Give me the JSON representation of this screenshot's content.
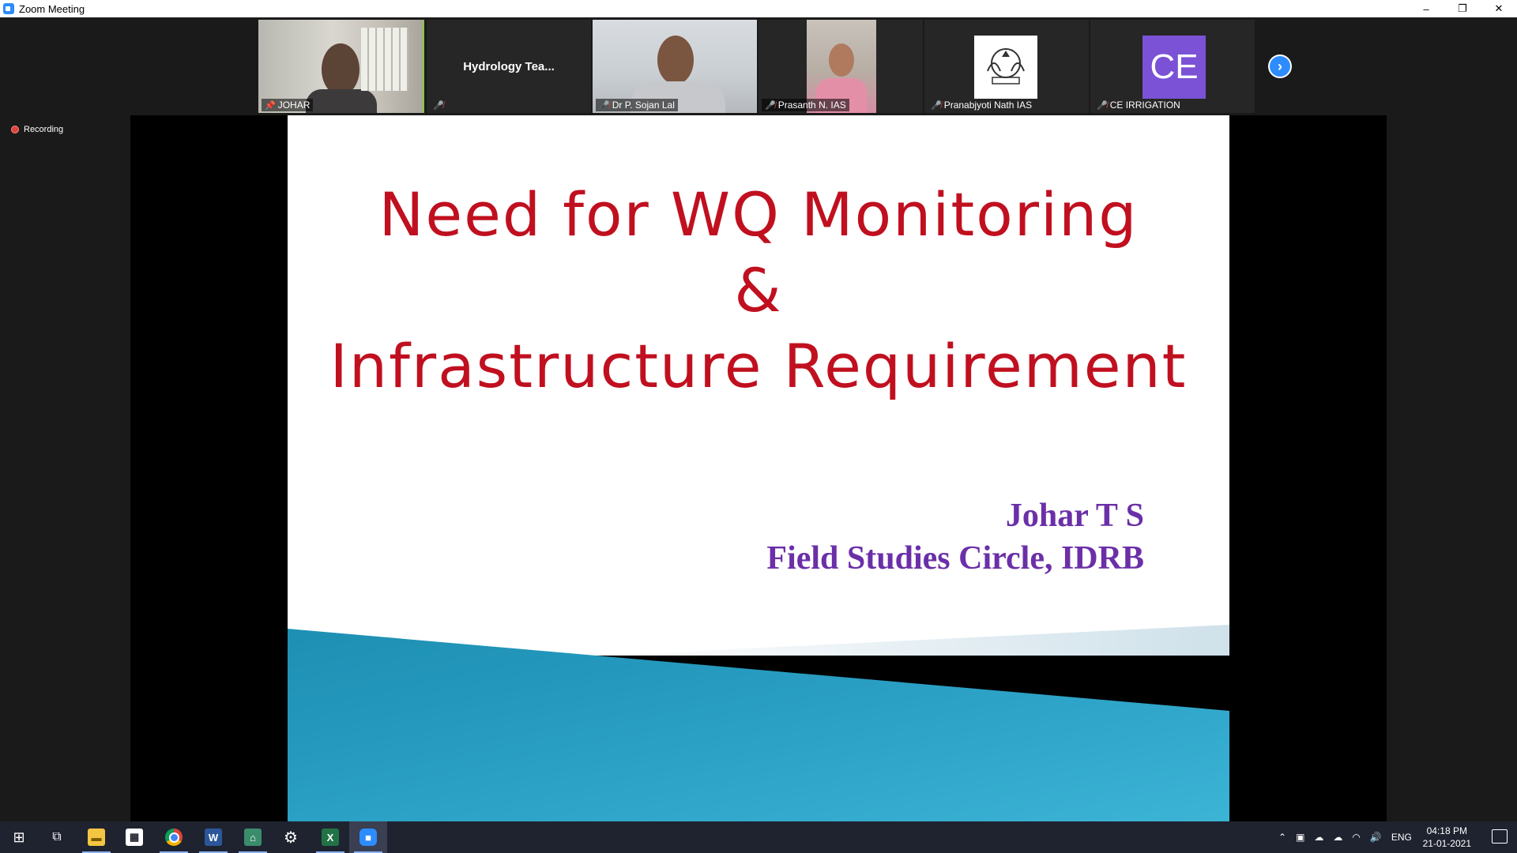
{
  "window": {
    "title": "Zoom Meeting",
    "controls": [
      "–",
      "❐",
      "✕"
    ]
  },
  "participants": [
    {
      "name": "JOHAR",
      "type": "video",
      "pinned": true,
      "active_speaker": true,
      "muted": false
    },
    {
      "name": "Hydrology  Tea...",
      "type": "name_only",
      "muted": true
    },
    {
      "name": "Dr P. Sojan Lal",
      "type": "video",
      "muted": true
    },
    {
      "name": "Prasanth N. IAS",
      "type": "video",
      "muted": true
    },
    {
      "name": "Pranabjyoti Nath IAS",
      "type": "image",
      "muted": true
    },
    {
      "name": "CE IRRIGATION",
      "type": "avatar",
      "initials": "CE",
      "avatar_color": "#7b52d6",
      "muted": true
    }
  ],
  "recording": {
    "label": "Recording"
  },
  "slide": {
    "title_lines": [
      "Need for WQ Monitoring",
      "&",
      "Infrastructure Requirement"
    ],
    "presenter_name": "Johar T S",
    "presenter_org": "Field Studies Circle, IDRB",
    "title_color": "#c0101f",
    "presenter_color": "#6b2fa8",
    "accent_color": "#2a9bbd"
  },
  "taskbar": {
    "apps": [
      {
        "name": "windows-start-icon",
        "glyph": "⊞"
      },
      {
        "name": "task-view-icon",
        "glyph": "⧉"
      },
      {
        "name": "file-explorer-icon",
        "glyph": "📁"
      },
      {
        "name": "store-icon",
        "glyph": "🛍"
      },
      {
        "name": "chrome-icon",
        "glyph": "●"
      },
      {
        "name": "word-icon",
        "glyph": "W"
      },
      {
        "name": "network-app-icon",
        "glyph": "⚙"
      },
      {
        "name": "settings-icon",
        "glyph": "⚙"
      },
      {
        "name": "excel-icon",
        "glyph": "X"
      },
      {
        "name": "zoom-icon",
        "glyph": "▶"
      }
    ],
    "language": "ENG",
    "time": "04:18 PM",
    "date": "21-01-2021"
  }
}
